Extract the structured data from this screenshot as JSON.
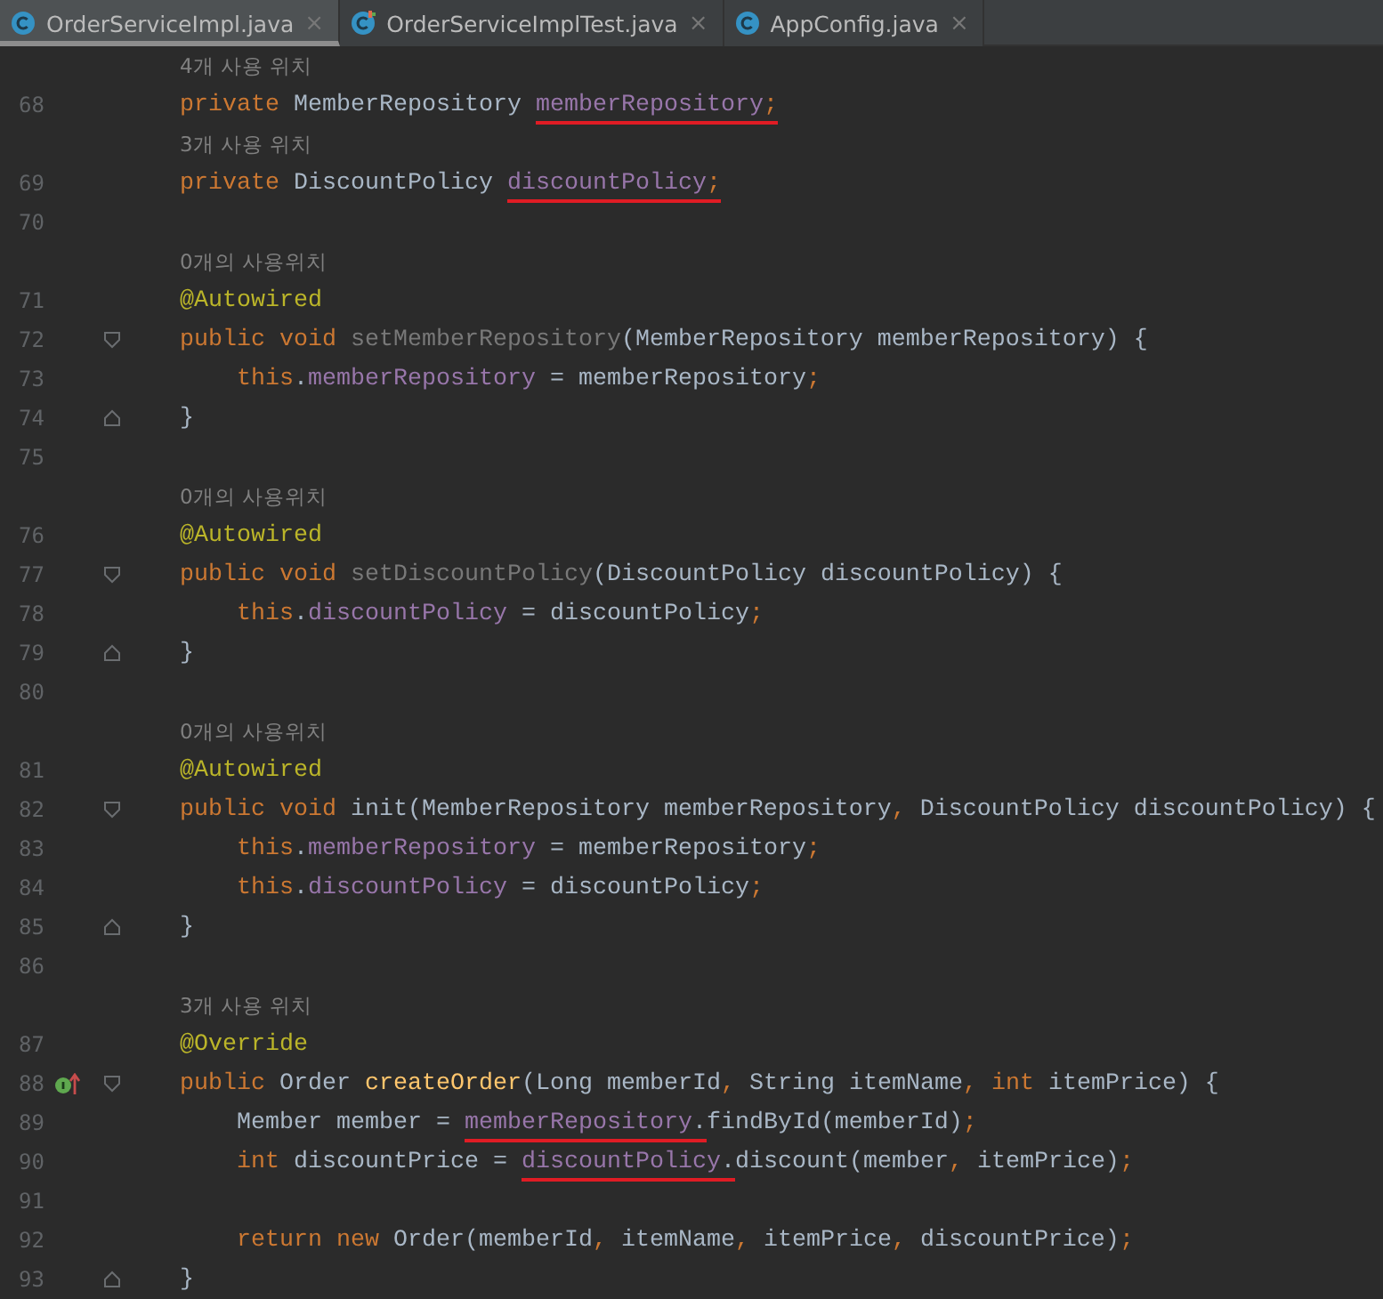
{
  "tabs": [
    {
      "label": "OrderServiceImpl.java",
      "close": "×",
      "selected": true,
      "kind": "class"
    },
    {
      "label": "OrderServiceImplTest.java",
      "close": "×",
      "selected": false,
      "kind": "test"
    },
    {
      "label": "AppConfig.java",
      "close": "×",
      "selected": false,
      "kind": "class"
    }
  ],
  "rows": [
    {
      "kind": "hint",
      "text": "4개 사용 위치"
    },
    {
      "kind": "code",
      "number": "68",
      "tokens": [
        {
          "text": "private ",
          "kind": "kw",
          "underlined": false
        },
        {
          "text": "MemberRepository ",
          "kind": "plain",
          "underlined": false
        },
        {
          "text": "memberRepository",
          "kind": "field",
          "underlined": true
        },
        {
          "text": ";",
          "kind": "kw",
          "underlined": true
        }
      ]
    },
    {
      "kind": "hint",
      "text": "3개 사용 위치"
    },
    {
      "kind": "code",
      "number": "69",
      "tokens": [
        {
          "text": "private ",
          "kind": "kw",
          "underlined": false
        },
        {
          "text": "DiscountPolicy ",
          "kind": "plain",
          "underlined": false
        },
        {
          "text": "discountPolicy",
          "kind": "field",
          "underlined": true
        },
        {
          "text": ";",
          "kind": "kw",
          "underlined": true
        }
      ]
    },
    {
      "kind": "code",
      "number": "70",
      "tokens": []
    },
    {
      "kind": "hint",
      "text": "0개의 사용위치"
    },
    {
      "kind": "code",
      "number": "71",
      "tokens": [
        {
          "text": "@Autowired",
          "kind": "ann",
          "underlined": false
        }
      ]
    },
    {
      "kind": "code",
      "number": "72",
      "fold_open": true,
      "tokens": [
        {
          "text": "public void ",
          "kind": "kw",
          "underlined": false
        },
        {
          "text": "setMemberRepository",
          "kind": "unused",
          "underlined": false
        },
        {
          "text": "(MemberRepository memberRepository) {",
          "kind": "plain",
          "underlined": false
        }
      ]
    },
    {
      "kind": "code",
      "number": "73",
      "tokens": [
        {
          "text": "    this",
          "kind": "kw",
          "underlined": false
        },
        {
          "text": ".",
          "kind": "plain",
          "underlined": false
        },
        {
          "text": "memberRepository",
          "kind": "field",
          "underlined": false
        },
        {
          "text": " = memberRepository",
          "kind": "plain",
          "underlined": false
        },
        {
          "text": ";",
          "kind": "kw",
          "underlined": false
        }
      ]
    },
    {
      "kind": "code",
      "number": "74",
      "fold_close": true,
      "tokens": [
        {
          "text": "}",
          "kind": "plain",
          "underlined": false
        }
      ]
    },
    {
      "kind": "code",
      "number": "75",
      "tokens": []
    },
    {
      "kind": "hint",
      "text": "0개의 사용위치"
    },
    {
      "kind": "code",
      "number": "76",
      "tokens": [
        {
          "text": "@Autowired",
          "kind": "ann",
          "underlined": false
        }
      ]
    },
    {
      "kind": "code",
      "number": "77",
      "fold_open": true,
      "tokens": [
        {
          "text": "public void ",
          "kind": "kw",
          "underlined": false
        },
        {
          "text": "setDiscountPolicy",
          "kind": "unused",
          "underlined": false
        },
        {
          "text": "(DiscountPolicy discountPolicy) {",
          "kind": "plain",
          "underlined": false
        }
      ]
    },
    {
      "kind": "code",
      "number": "78",
      "tokens": [
        {
          "text": "    this",
          "kind": "kw",
          "underlined": false
        },
        {
          "text": ".",
          "kind": "plain",
          "underlined": false
        },
        {
          "text": "discountPolicy",
          "kind": "field",
          "underlined": false
        },
        {
          "text": " = discountPolicy",
          "kind": "plain",
          "underlined": false
        },
        {
          "text": ";",
          "kind": "kw",
          "underlined": false
        }
      ]
    },
    {
      "kind": "code",
      "number": "79",
      "fold_close": true,
      "tokens": [
        {
          "text": "}",
          "kind": "plain",
          "underlined": false
        }
      ]
    },
    {
      "kind": "code",
      "number": "80",
      "tokens": []
    },
    {
      "kind": "hint",
      "text": "0개의 사용위치"
    },
    {
      "kind": "code",
      "number": "81",
      "tokens": [
        {
          "text": "@Autowired",
          "kind": "ann",
          "underlined": false
        }
      ]
    },
    {
      "kind": "code",
      "number": "82",
      "fold_open": true,
      "tokens": [
        {
          "text": "public void ",
          "kind": "kw",
          "underlined": false
        },
        {
          "text": "init(MemberRepository memberRepository",
          "kind": "plain",
          "underlined": false
        },
        {
          "text": ", ",
          "kind": "kw",
          "underlined": false
        },
        {
          "text": "DiscountPolicy discountPolicy) {",
          "kind": "plain",
          "underlined": false
        }
      ]
    },
    {
      "kind": "code",
      "number": "83",
      "tokens": [
        {
          "text": "    this",
          "kind": "kw",
          "underlined": false
        },
        {
          "text": ".",
          "kind": "plain",
          "underlined": false
        },
        {
          "text": "memberRepository",
          "kind": "field",
          "underlined": false
        },
        {
          "text": " = memberRepository",
          "kind": "plain",
          "underlined": false
        },
        {
          "text": ";",
          "kind": "kw",
          "underlined": false
        }
      ]
    },
    {
      "kind": "code",
      "number": "84",
      "tokens": [
        {
          "text": "    this",
          "kind": "kw",
          "underlined": false
        },
        {
          "text": ".",
          "kind": "plain",
          "underlined": false
        },
        {
          "text": "discountPolicy",
          "kind": "field",
          "underlined": false
        },
        {
          "text": " = discountPolicy",
          "kind": "plain",
          "underlined": false
        },
        {
          "text": ";",
          "kind": "kw",
          "underlined": false
        }
      ]
    },
    {
      "kind": "code",
      "number": "85",
      "fold_close": true,
      "tokens": [
        {
          "text": "}",
          "kind": "plain",
          "underlined": false
        }
      ]
    },
    {
      "kind": "code",
      "number": "86",
      "tokens": []
    },
    {
      "kind": "hint",
      "text": "3개 사용 위치"
    },
    {
      "kind": "code",
      "number": "87",
      "tokens": [
        {
          "text": "@Override",
          "kind": "ann",
          "underlined": false
        }
      ]
    },
    {
      "kind": "code",
      "number": "88",
      "fold_open": true,
      "override_marker": true,
      "tokens": [
        {
          "text": "public ",
          "kind": "kw",
          "underlined": false
        },
        {
          "text": "Order ",
          "kind": "plain",
          "underlined": false
        },
        {
          "text": "createOrder",
          "kind": "method",
          "underlined": false
        },
        {
          "text": "(Long memberId",
          "kind": "plain",
          "underlined": false
        },
        {
          "text": ", ",
          "kind": "kw",
          "underlined": false
        },
        {
          "text": "String itemName",
          "kind": "plain",
          "underlined": false
        },
        {
          "text": ", ",
          "kind": "kw",
          "underlined": false
        },
        {
          "text": "int ",
          "kind": "kw",
          "underlined": false
        },
        {
          "text": "itemPrice) {",
          "kind": "plain",
          "underlined": false
        }
      ]
    },
    {
      "kind": "code",
      "number": "89",
      "tokens": [
        {
          "text": "    Member member = ",
          "kind": "plain",
          "underlined": false
        },
        {
          "text": "memberRepository",
          "kind": "field",
          "underlined": true
        },
        {
          "text": ".",
          "kind": "plain",
          "underlined": true
        },
        {
          "text": "findById(memberId)",
          "kind": "plain",
          "underlined": false
        },
        {
          "text": ";",
          "kind": "kw",
          "underlined": false
        }
      ]
    },
    {
      "kind": "code",
      "number": "90",
      "tokens": [
        {
          "text": "    int ",
          "kind": "kw",
          "underlined": false
        },
        {
          "text": "discountPrice = ",
          "kind": "plain",
          "underlined": false
        },
        {
          "text": "discountPolicy",
          "kind": "field",
          "underlined": true
        },
        {
          "text": ".",
          "kind": "plain",
          "underlined": true
        },
        {
          "text": "discount(member",
          "kind": "plain",
          "underlined": false
        },
        {
          "text": ", ",
          "kind": "kw",
          "underlined": false
        },
        {
          "text": "itemPrice)",
          "kind": "plain",
          "underlined": false
        },
        {
          "text": ";",
          "kind": "kw",
          "underlined": false
        }
      ]
    },
    {
      "kind": "code",
      "number": "91",
      "tokens": []
    },
    {
      "kind": "code",
      "number": "92",
      "tokens": [
        {
          "text": "    return new ",
          "kind": "kw",
          "underlined": false
        },
        {
          "text": "Order(memberId",
          "kind": "plain",
          "underlined": false
        },
        {
          "text": ", ",
          "kind": "kw",
          "underlined": false
        },
        {
          "text": "itemName",
          "kind": "plain",
          "underlined": false
        },
        {
          "text": ", ",
          "kind": "kw",
          "underlined": false
        },
        {
          "text": "itemPrice",
          "kind": "plain",
          "underlined": false
        },
        {
          "text": ", ",
          "kind": "kw",
          "underlined": false
        },
        {
          "text": "discountPrice)",
          "kind": "plain",
          "underlined": false
        },
        {
          "text": ";",
          "kind": "kw",
          "underlined": false
        }
      ]
    },
    {
      "kind": "code",
      "number": "93",
      "fold_close": true,
      "tokens": [
        {
          "text": "}",
          "kind": "plain",
          "underlined": false
        }
      ]
    }
  ]
}
